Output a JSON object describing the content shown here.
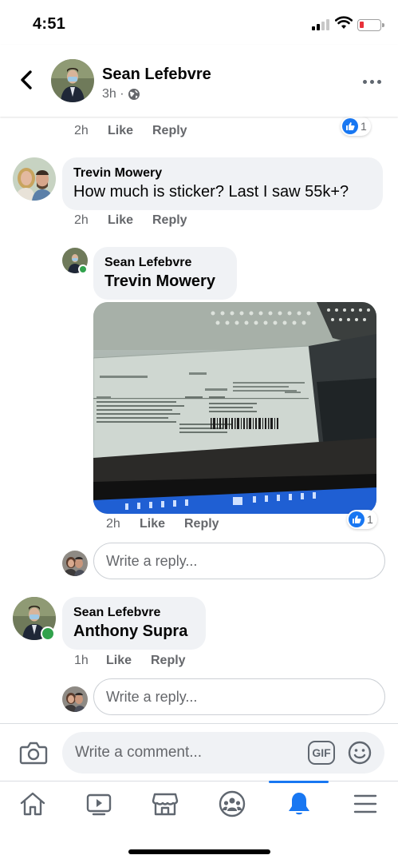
{
  "status_bar": {
    "time": "4:51",
    "battery_color": "#e8313a"
  },
  "header": {
    "name": "Sean Lefebvre",
    "time": "3h ·",
    "audience_icon": "globe-icon",
    "back_icon": "chevron-left-icon",
    "more_icon": "more-horizontal-icon"
  },
  "top_comment": {
    "time": "2h",
    "like_label": "Like",
    "reply_label": "Reply",
    "reaction_count": "1"
  },
  "comment_trevin": {
    "author": "Trevin Mowery",
    "text": "How much is sticker? Last I saw 55k+?",
    "time": "2h",
    "like_label": "Like",
    "reply_label": "Reply"
  },
  "reply_sean": {
    "author": "Sean Lefebvre",
    "mention": "Trevin Mowery",
    "time": "2h",
    "like_label": "Like",
    "reply_label": "Reply",
    "reaction_count": "1"
  },
  "reply_box_1": {
    "placeholder": "Write a reply..."
  },
  "comment_anthony": {
    "author": "Sean Lefebvre",
    "mention": "Anthony Supra",
    "time": "1h",
    "like_label": "Like",
    "reply_label": "Reply"
  },
  "reply_box_2": {
    "placeholder": "Write a reply..."
  },
  "composer": {
    "placeholder": "Write a comment...",
    "gif_label": "GIF",
    "camera_icon": "camera-icon",
    "emoji_icon": "emoji-icon"
  },
  "tabs": [
    {
      "icon": "home-icon",
      "active": false
    },
    {
      "icon": "watch-icon",
      "active": false
    },
    {
      "icon": "marketplace-icon",
      "active": false
    },
    {
      "icon": "groups-icon",
      "active": false
    },
    {
      "icon": "notifications-bell-icon",
      "active": true
    },
    {
      "icon": "menu-icon",
      "active": false
    }
  ],
  "colors": {
    "accent": "#1877f2",
    "online": "#31a24c",
    "bubble": "#f0f2f5",
    "secondary_text": "#65676b"
  }
}
